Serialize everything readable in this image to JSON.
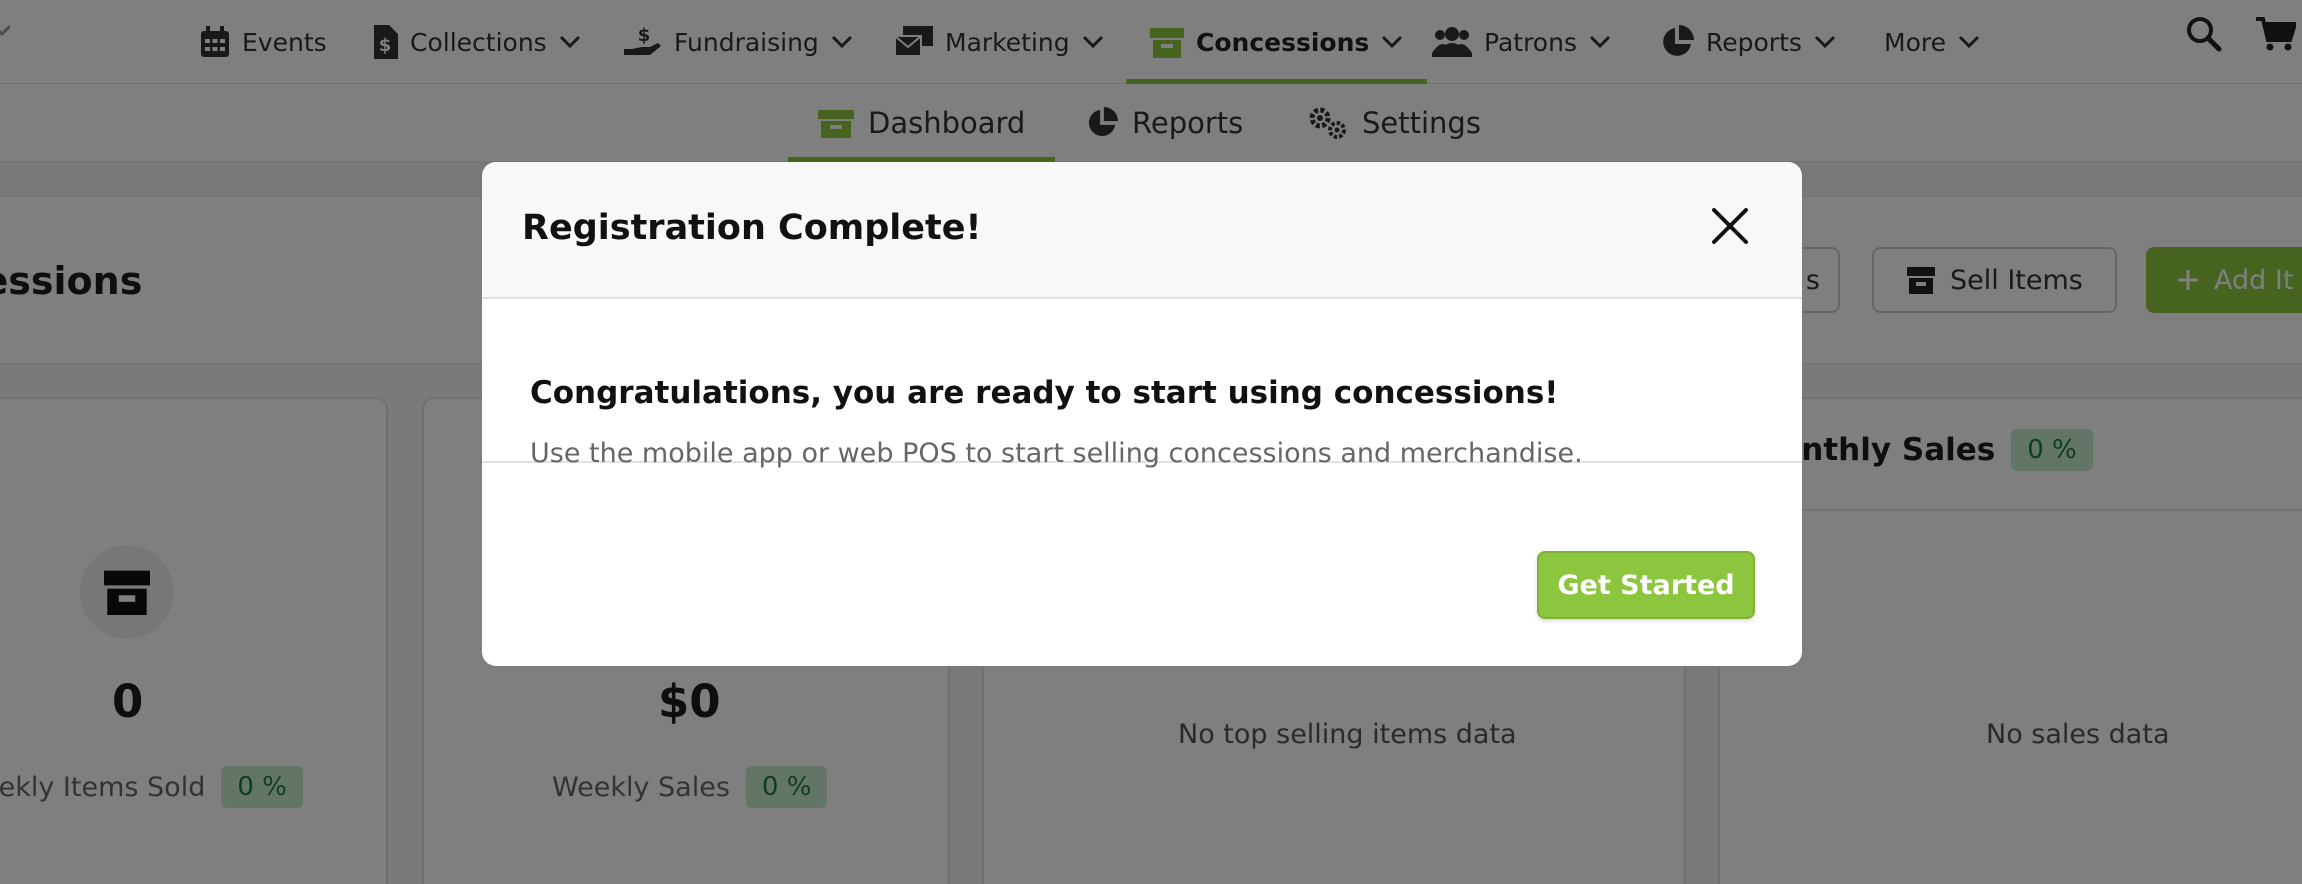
{
  "colors": {
    "accent_green": "#8cc63f",
    "badge_green_bg": "#c7ebcf",
    "badge_green_text": "#1e7a3a"
  },
  "topnav": {
    "items": [
      {
        "label": "Events",
        "icon": "calendar-icon",
        "has_dropdown": false
      },
      {
        "label": "Collections",
        "icon": "document-dollar-icon",
        "has_dropdown": true
      },
      {
        "label": "Fundraising",
        "icon": "hand-dollar-icon",
        "has_dropdown": true
      },
      {
        "label": "Marketing",
        "icon": "mail-stack-icon",
        "has_dropdown": true
      },
      {
        "label": "Concessions",
        "icon": "store-box-icon",
        "has_dropdown": true,
        "active": true
      },
      {
        "label": "Patrons",
        "icon": "users-icon",
        "has_dropdown": true
      },
      {
        "label": "Reports",
        "icon": "pie-chart-icon",
        "has_dropdown": true
      },
      {
        "label": "More",
        "icon": "",
        "has_dropdown": true
      }
    ],
    "search_icon": "search-icon",
    "cart_icon": "cart-icon"
  },
  "subnav": {
    "items": [
      {
        "label": "Dashboard",
        "icon": "store-box-icon",
        "active": true
      },
      {
        "label": "Reports",
        "icon": "pie-chart-icon"
      },
      {
        "label": "Settings",
        "icon": "gears-icon"
      }
    ]
  },
  "page": {
    "title": "cessions",
    "partial_button": "s",
    "sell_items_label": "Sell Items",
    "add_item_label": "Add It"
  },
  "cards": {
    "items_sold": {
      "value": "0",
      "label": "eekly Items Sold",
      "change": "0 %"
    },
    "sales": {
      "value": "$0",
      "label": "Weekly Sales",
      "change": "0 %"
    },
    "top_selling": {
      "empty_text": "No top selling items data"
    },
    "monthly_sales": {
      "title": "onthly Sales",
      "change": "0 %",
      "empty_text": "No sales data"
    }
  },
  "modal": {
    "title": "Registration Complete!",
    "heading": "Congratulations, you are ready to start using concessions!",
    "text": "Use the mobile app or web POS to start selling concessions and merchandise.",
    "button_label": "Get Started"
  }
}
